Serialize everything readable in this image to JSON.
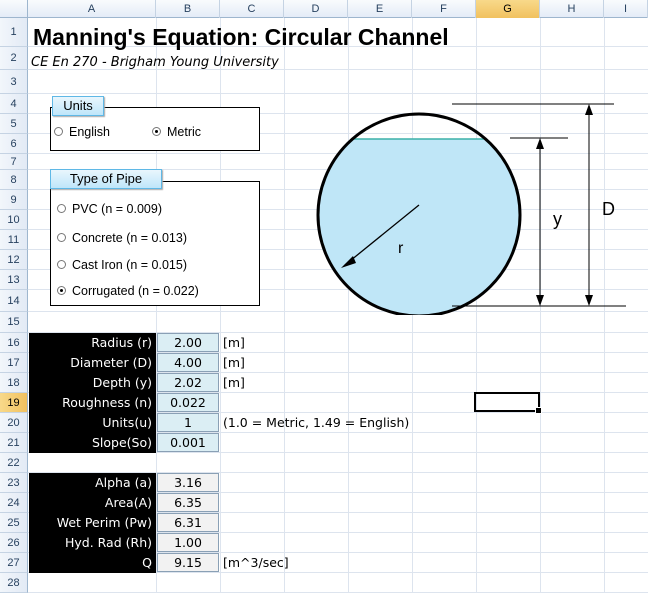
{
  "sheet": {
    "columns": [
      "A",
      "B",
      "C",
      "D",
      "E",
      "F",
      "G",
      "H",
      "I"
    ],
    "selected_column": "G",
    "rows": [
      "1",
      "2",
      "3",
      "4",
      "5",
      "6",
      "7",
      "8",
      "9",
      "10",
      "11",
      "12",
      "13",
      "14",
      "15",
      "16",
      "17",
      "18",
      "19",
      "20",
      "21",
      "22",
      "23",
      "24",
      "25",
      "26",
      "27",
      "28"
    ],
    "selected_row": "19"
  },
  "title": "Manning's Equation: Circular Channel",
  "subtitle": "CE En 270 - Brigham Young University",
  "units_group": {
    "label": "Units",
    "options": [
      {
        "label": "English",
        "selected": false
      },
      {
        "label": "Metric",
        "selected": true
      }
    ]
  },
  "pipe_group": {
    "label": "Type of Pipe",
    "options": [
      {
        "label": "PVC (n = 0.009)",
        "selected": false
      },
      {
        "label": "Concrete (n = 0.013)",
        "selected": false
      },
      {
        "label": "Cast Iron (n = 0.015)",
        "selected": false
      },
      {
        "label": "Corrugated (n = 0.022)",
        "selected": true
      }
    ]
  },
  "diagram": {
    "radius_label": "r",
    "depth_label": "y",
    "diameter_label": "D",
    "water_color": "#bfe6f7",
    "water_line_color": "#3bb0a8"
  },
  "inputs": [
    {
      "label": "Radius (r)",
      "value": "2.00",
      "unit": "[m]"
    },
    {
      "label": "Diameter (D)",
      "value": "4.00",
      "unit": "[m]"
    },
    {
      "label": "Depth (y)",
      "value": "2.02",
      "unit": "[m]"
    },
    {
      "label": "Roughness (n)",
      "value": "0.022",
      "unit": ""
    },
    {
      "label": "Units(u)",
      "value": "1",
      "unit": "(1.0 = Metric, 1.49 = English)"
    },
    {
      "label": "Slope(So)",
      "value": "0.001",
      "unit": ""
    }
  ],
  "results": [
    {
      "label": "Alpha (a)",
      "value": "3.16",
      "unit": ""
    },
    {
      "label": "Area(A)",
      "value": "6.35",
      "unit": ""
    },
    {
      "label": "Wet Perim (Pw)",
      "value": "6.31",
      "unit": ""
    },
    {
      "label": "Hyd. Rad (Rh)",
      "value": "1.00",
      "unit": ""
    },
    {
      "label": "Q",
      "value": "9.15",
      "unit": "[m^3/sec]"
    }
  ]
}
